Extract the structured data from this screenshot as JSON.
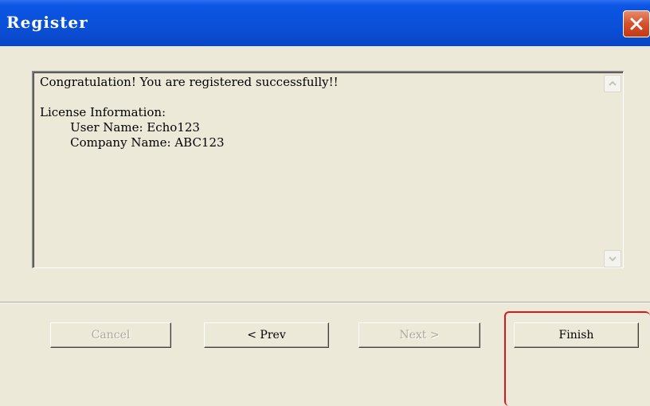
{
  "window": {
    "title": "Register",
    "close_icon": "close-icon"
  },
  "message_box": {
    "lines": [
      "Congratulation! You are registered successfully!!",
      "",
      "License Information:",
      "        User Name: Echo123",
      "        Company Name: ABC123"
    ]
  },
  "buttons": {
    "cancel": "Cancel",
    "prev": "< Prev",
    "next": "Next >",
    "finish": "Finish"
  },
  "colors": {
    "title_bar": "#0a4fd8",
    "close_button": "#d5512c",
    "dialog_background": "#ece9d8",
    "highlight": "#e0161a"
  }
}
